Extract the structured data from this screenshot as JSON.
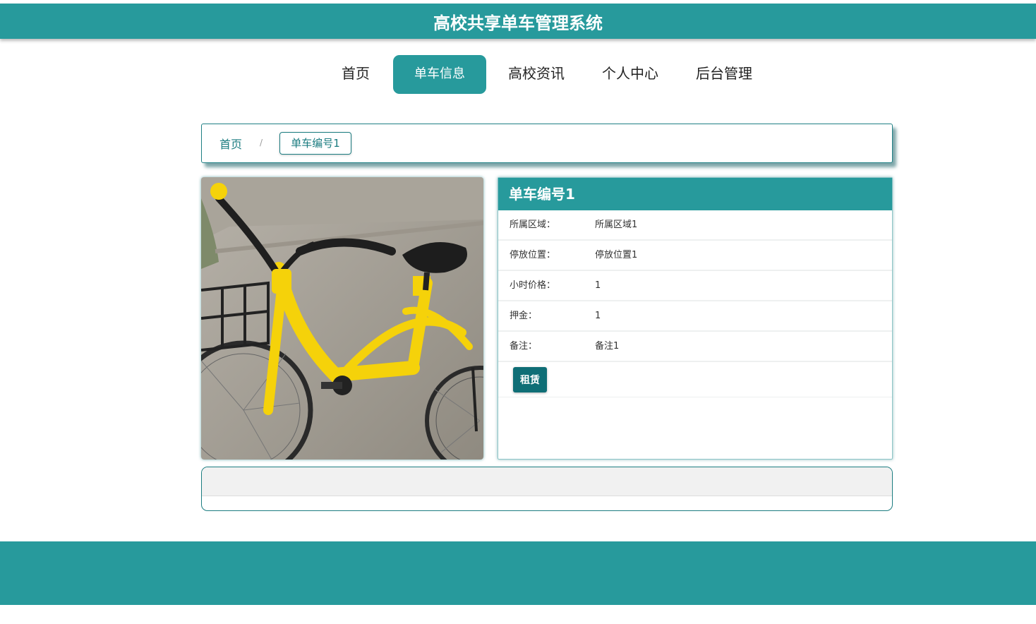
{
  "site": {
    "title": "高校共享单车管理系统"
  },
  "nav": {
    "items": [
      {
        "label": "首页"
      },
      {
        "label": "单车信息"
      },
      {
        "label": "高校资讯"
      },
      {
        "label": "个人中心"
      },
      {
        "label": "后台管理"
      }
    ],
    "active_index": 1
  },
  "breadcrumb": {
    "home": "首页",
    "separator": "/",
    "current": "单车编号1"
  },
  "detail": {
    "title": "单车编号1",
    "fields": [
      {
        "key": "所属区域：",
        "value": "所属区域1"
      },
      {
        "key": "停放位置：",
        "value": "停放位置1"
      },
      {
        "key": "小时价格：",
        "value": "1"
      },
      {
        "key": "押金：",
        "value": "1"
      },
      {
        "key": "备注：",
        "value": "备注1"
      }
    ],
    "rent_label": "租赁"
  },
  "colors": {
    "primary": "#279a9c",
    "dark_teal": "#0f6e76",
    "bike_yellow": "#f5d20a"
  },
  "image": {
    "subject": "yellow-shared-bicycle"
  }
}
